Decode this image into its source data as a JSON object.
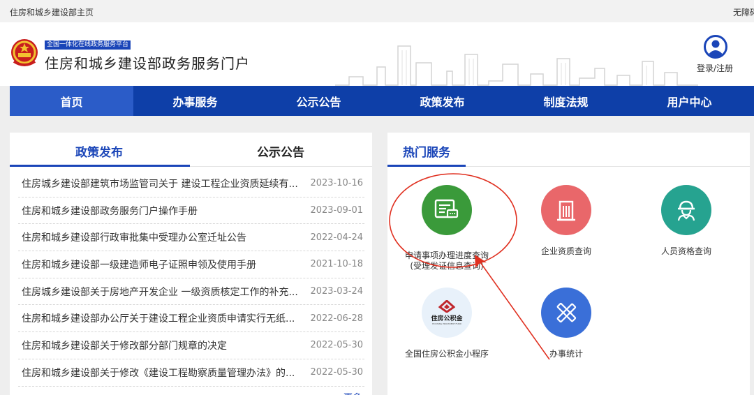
{
  "topbar": {
    "home_link": "住房和城乡建设部主页",
    "accessibility": "无障碍"
  },
  "header": {
    "badge": "全国一体化在线政务服务平台",
    "title": "住房和城乡建设部政务服务门户",
    "login": "登录/注册"
  },
  "nav": [
    "首页",
    "办事服务",
    "公示公告",
    "政策发布",
    "制度法规",
    "用户中心"
  ],
  "left_panel": {
    "tabs": [
      "政策发布",
      "公示公告"
    ],
    "items": [
      {
        "title": "住房城乡建设部建筑市场监管司关于 建设工程企业资质延续有...",
        "date": "2023-10-16"
      },
      {
        "title": "住房和城乡建设部政务服务门户操作手册",
        "date": "2023-09-01"
      },
      {
        "title": "住房和城乡建设部行政审批集中受理办公室迁址公告",
        "date": "2022-04-24"
      },
      {
        "title": "住房和城乡建设部一级建造师电子证照申领及使用手册",
        "date": "2021-10-18"
      },
      {
        "title": "住房城乡建设部关于房地产开发企业 一级资质核定工作的补充...",
        "date": "2023-03-24"
      },
      {
        "title": "住房和城乡建设部办公厅关于建设工程企业资质申请实行无纸...",
        "date": "2022-06-28"
      },
      {
        "title": "住房和城乡建设部关于修改部分部门规章的决定",
        "date": "2022-05-30"
      },
      {
        "title": "住房和城乡建设部关于修改《建设工程勘察质量管理办法》的...",
        "date": "2022-05-30"
      }
    ],
    "more": "更多"
  },
  "right_panel": {
    "title": "热门服务",
    "services": [
      {
        "line1": "申请事项办理进度查询",
        "line2": "(受理发证信息查询)",
        "color": "#3a9a3a"
      },
      {
        "line1": "企业资质查询",
        "line2": "",
        "color": "#e9676a"
      },
      {
        "line1": "人员资格查询",
        "line2": "",
        "color": "#26a390"
      },
      {
        "line1": "全国住房公积金小程序",
        "line2": "",
        "color": "#e8f1fa"
      },
      {
        "line1": "办事统计",
        "line2": "",
        "color": "#3a6fd8"
      }
    ],
    "logo_text": "住房公积金",
    "logo_sub": "HOUSING PROVIDENT FUND"
  },
  "colors": {
    "nav_bg": "#0e3fa8",
    "nav_active": "#2b5cc8",
    "accent": "#1a45b8",
    "annotation": "#e03020"
  }
}
